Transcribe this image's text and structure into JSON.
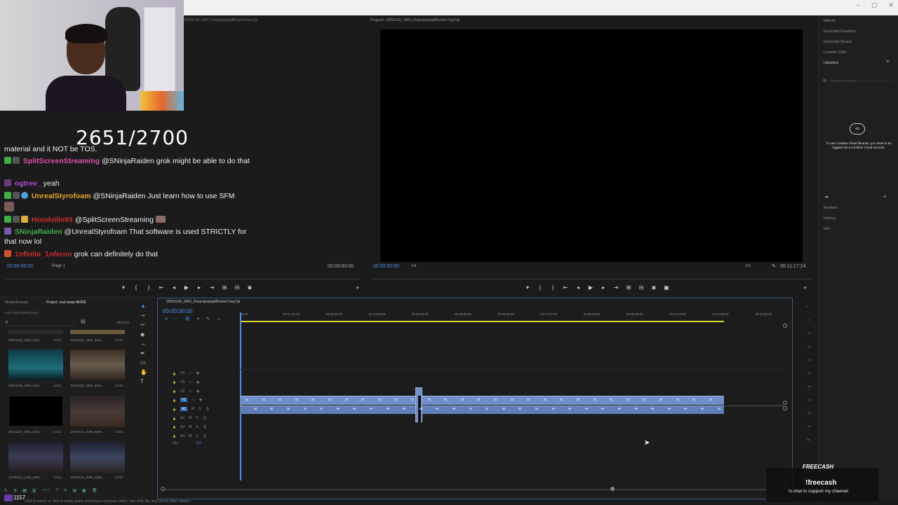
{
  "window": {
    "controls": [
      "–",
      "▢",
      "✕"
    ]
  },
  "overlay": {
    "sub_counter": "2651/2700",
    "viewer_count": "1157",
    "freecash": {
      "brand": "FREECASH",
      "command": "!freecash",
      "subtitle": "in chat to support my channel"
    }
  },
  "chat": {
    "lines": [
      {
        "user": "",
        "color": "#ffffff",
        "text": "material and it NOT be TOS."
      },
      {
        "user": "SplitScreenStreaming",
        "color": "#e04ea8",
        "text": "@SNinjaRaiden grok might be able to do that"
      },
      {
        "user": "ogtrev_",
        "color": "#b24ad6",
        "text": "yeah"
      },
      {
        "user": "UnrealStyrofoam",
        "color": "#e0a52a",
        "text": "@SNinjaRaiden Just learn how to use SFM"
      },
      {
        "user": "Hoodville93",
        "color": "#c92b2b",
        "text": "@SplitScreenStreaming"
      },
      {
        "user": "SNinjaRaiden",
        "color": "#8a5cd6",
        "text": "@UnrealStyrofoam That software is used STRICTLY for that now lol"
      },
      {
        "user": "1nfinite_1nferno",
        "color": "#c92b2b",
        "text": "grok can definitely do that"
      }
    ]
  },
  "source_monitor": {
    "title": "20251120_1902_01kacsjoejeg481emrv7acp7gt",
    "timecode_left": "00:00:00:00",
    "page": "Page 1",
    "timecode_right": "00:00:00:00"
  },
  "program_monitor": {
    "title": "Program: 20251120_1902_01kacsjoejeg481emrv7acp7gt",
    "timecode_left": "00:00:00:00",
    "fit": "Fit",
    "resolution": "1/2",
    "duration": "00:11:17:24"
  },
  "right_panel": {
    "items": [
      "Effects",
      "Essential Graphics",
      "Essential Sound",
      "Lumetri Color",
      "Libraries"
    ],
    "search_placeholder": "Search all libraries",
    "cc_message": "To use Creative Cloud libraries, you need to be logged into a Creative Cloud account.",
    "bottom_items": [
      "Markers",
      "History",
      "Info"
    ]
  },
  "project": {
    "tabs": [
      "Media Browser",
      "Project: soul swap MORE"
    ],
    "file": "soul swap MORE.prproj",
    "item_count": "60 items",
    "clips": [
      {
        "name": "20251120_1900_01ka...",
        "dur": "14:21",
        "color": "#1f6f7a"
      },
      {
        "name": "20251120_1902_01ka...",
        "dur": "14:21",
        "color": "#6a5d4f"
      },
      {
        "name": "20251120_1954_01ka...",
        "dur": "14:21",
        "color": "#000000"
      },
      {
        "name": "19700121_0155_6920...",
        "dur": "14:21",
        "color": "#4a3a35"
      },
      {
        "name": "20251120_1902_0...",
        "dur": "11:17:24",
        "color": "#3a3e55"
      },
      {
        "name": "19700121_0155_6920...",
        "dur": "14:21",
        "color": "#3d4660"
      },
      {
        "name": "19700121_0155_6920...",
        "dur": "14:21",
        "color": "#2d3140"
      },
      {
        "name": "19700121_0155_6920...",
        "dur": "14:21",
        "color": "#3b4258"
      }
    ]
  },
  "timeline": {
    "tab": "20251120_1902_01kacsjoejeg481emrv7acp7gt",
    "timecode": "00:00:00:00",
    "ruler": [
      "00:00",
      "00:01:00:00",
      "00:02:00:00",
      "00:03:00:00",
      "00:04:00:00",
      "00:05:00:00",
      "00:06:00:00",
      "00:07:00:00",
      "00:08:00:00",
      "00:09:00:00",
      "00:10:00:00",
      "00:11:00:00",
      "00:12:00:00"
    ],
    "video_tracks": [
      "V4",
      "V3",
      "V2",
      "V1"
    ],
    "audio_tracks": [
      "A1",
      "A2",
      "A3",
      "A4"
    ],
    "mix_label": "Mix",
    "mix_value": "0.0"
  },
  "meter": {
    "labels": [
      "0",
      "-6",
      "-12",
      "-18",
      "-24",
      "-30",
      "-36",
      "-42",
      "-48",
      "-54",
      "dB"
    ]
  },
  "status": {
    "hint": "Click to select, or click in empty space and drag to marquee select. Use Shift, Alt, and Ctrl for other options."
  }
}
